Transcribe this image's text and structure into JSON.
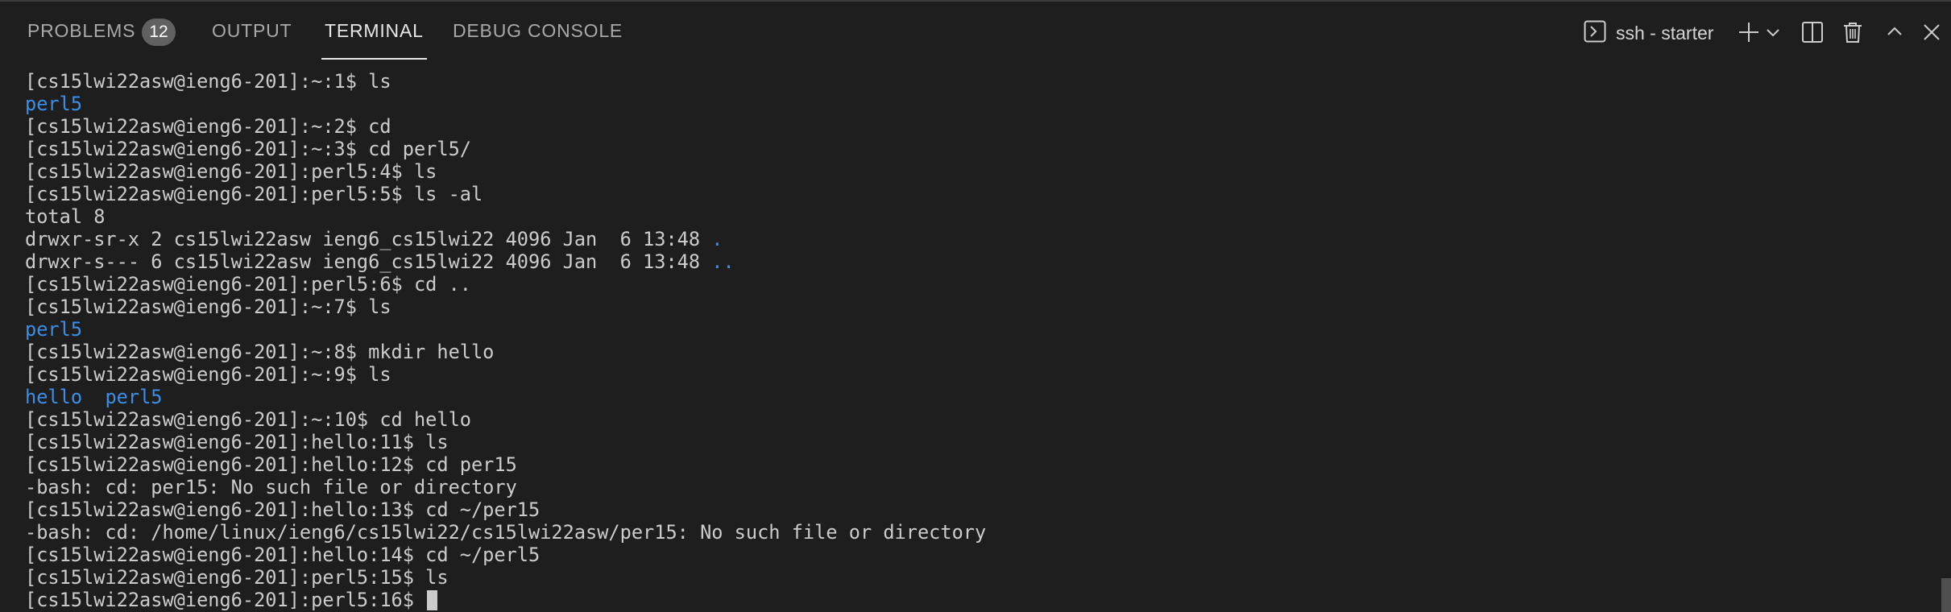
{
  "tabs": [
    {
      "label": "PROBLEMS",
      "badge": "12"
    },
    {
      "label": "OUTPUT"
    },
    {
      "label": "TERMINAL",
      "active": true
    },
    {
      "label": "DEBUG CONSOLE"
    }
  ],
  "toolbar": {
    "launch_profile": "ssh - starter",
    "icons": [
      "terminal-icon",
      "plus-icon",
      "chevron-down-icon",
      "split-icon",
      "trash-icon",
      "chevron-up-icon",
      "close-icon"
    ]
  },
  "terminal": {
    "lines": [
      [
        {
          "t": "[cs15lwi22asw@ieng6-201]:~:1$ ls"
        }
      ],
      [
        {
          "t": "perl5",
          "dir": true
        }
      ],
      [
        {
          "t": "[cs15lwi22asw@ieng6-201]:~:2$ cd"
        }
      ],
      [
        {
          "t": "[cs15lwi22asw@ieng6-201]:~:3$ cd perl5/"
        }
      ],
      [
        {
          "t": "[cs15lwi22asw@ieng6-201]:perl5:4$ ls"
        }
      ],
      [
        {
          "t": "[cs15lwi22asw@ieng6-201]:perl5:5$ ls -al"
        }
      ],
      [
        {
          "t": "total 8"
        }
      ],
      [
        {
          "t": "drwxr-sr-x 2 cs15lwi22asw ieng6_cs15lwi22 4096 Jan  6 13:48 "
        },
        {
          "t": ".",
          "dir": true
        }
      ],
      [
        {
          "t": "drwxr-s--- 6 cs15lwi22asw ieng6_cs15lwi22 4096 Jan  6 13:48 "
        },
        {
          "t": "..",
          "dir": true
        }
      ],
      [
        {
          "t": "[cs15lwi22asw@ieng6-201]:perl5:6$ cd .."
        }
      ],
      [
        {
          "t": "[cs15lwi22asw@ieng6-201]:~:7$ ls"
        }
      ],
      [
        {
          "t": "perl5",
          "dir": true
        }
      ],
      [
        {
          "t": "[cs15lwi22asw@ieng6-201]:~:8$ mkdir hello"
        }
      ],
      [
        {
          "t": "[cs15lwi22asw@ieng6-201]:~:9$ ls"
        }
      ],
      [
        {
          "t": "hello",
          "dir": true
        },
        {
          "t": "  "
        },
        {
          "t": "perl5",
          "dir": true
        }
      ],
      [
        {
          "t": "[cs15lwi22asw@ieng6-201]:~:10$ cd hello"
        }
      ],
      [
        {
          "t": "[cs15lwi22asw@ieng6-201]:hello:11$ ls"
        }
      ],
      [
        {
          "t": "[cs15lwi22asw@ieng6-201]:hello:12$ cd per15"
        }
      ],
      [
        {
          "t": "-bash: cd: per15: No such file or directory"
        }
      ],
      [
        {
          "t": "[cs15lwi22asw@ieng6-201]:hello:13$ cd ~/per15"
        }
      ],
      [
        {
          "t": "-bash: cd: /home/linux/ieng6/cs15lwi22/cs15lwi22asw/per15: No such file or directory"
        }
      ],
      [
        {
          "t": "[cs15lwi22asw@ieng6-201]:hello:14$ cd ~/perl5"
        }
      ],
      [
        {
          "t": "[cs15lwi22asw@ieng6-201]:perl5:15$ ls"
        }
      ],
      [
        {
          "t": "[cs15lwi22asw@ieng6-201]:perl5:16$ "
        },
        {
          "cursor": true
        }
      ]
    ]
  }
}
